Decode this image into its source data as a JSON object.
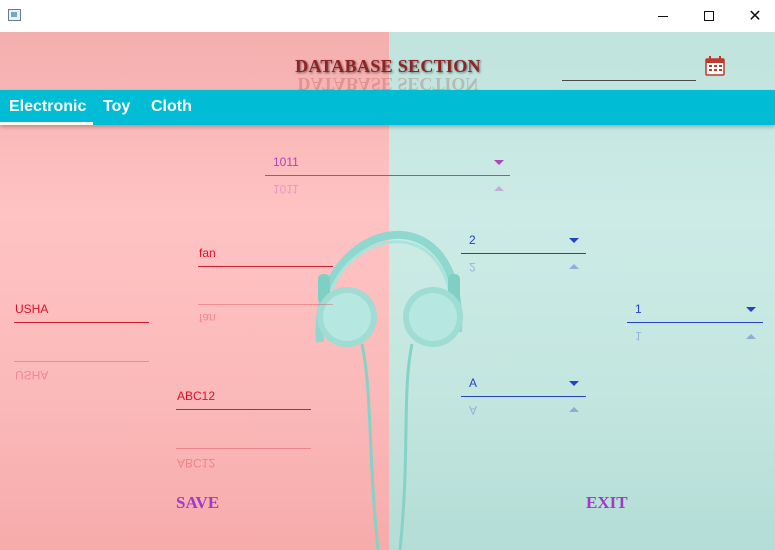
{
  "window": {
    "controls": {
      "minimize": "minimize-icon",
      "maximize": "maximize-icon",
      "close": "close-icon"
    },
    "close_glyph": "✕"
  },
  "header": {
    "title": "DATABASE SECTION",
    "date_value": "",
    "calendar_icon": "calendar-icon"
  },
  "tabs": [
    {
      "label": "Electronic",
      "selected": true
    },
    {
      "label": "Toy",
      "selected": false
    },
    {
      "label": "Cloth",
      "selected": false
    }
  ],
  "form": {
    "id_combo": {
      "value": "1011"
    },
    "name_field": {
      "value": "fan"
    },
    "brand_field": {
      "value": "USHA"
    },
    "model_field": {
      "value": "ABC12"
    },
    "qty_combo": {
      "value": "2"
    },
    "count_combo": {
      "value": "1"
    },
    "grade_combo": {
      "value": "A"
    }
  },
  "actions": {
    "save": "SAVE",
    "exit": "EXIT"
  },
  "colors": {
    "tab_bar": "#00bcd4",
    "left_panel": "#ffc3c3",
    "right_panel": "#cdebe6",
    "field_text": "#e0102c",
    "combo_purple": "#b044b8",
    "combo_blue": "#2442c8",
    "action_text": "#a03ac8"
  }
}
